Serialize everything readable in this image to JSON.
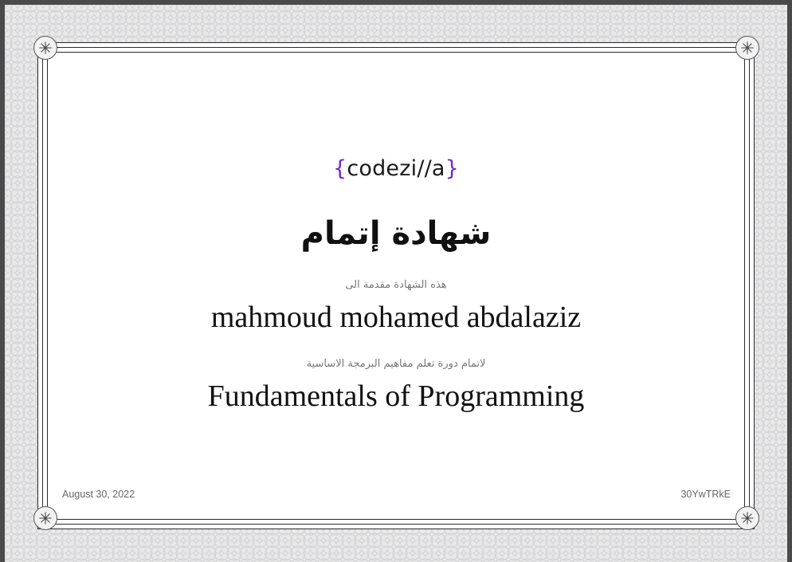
{
  "certificate": {
    "logo": {
      "open_brace": "{",
      "text": "codezi//a",
      "close_brace": "}"
    },
    "title": "شهادة إتمام",
    "presented_to_label": "هذه الشهادة مقدمة الى",
    "recipient_name": "mahmoud mohamed abdalaziz",
    "completion_label": "لاتمام دورة تعلم مفاهيم البرمجة الاساسية",
    "course_name": "Fundamentals of Programming",
    "date": "August 30, 2022",
    "certificate_id": "30YwTRkE"
  },
  "colors": {
    "brand_brace": "#6c2bd9",
    "frame": "#2a2a2a",
    "background_pattern": "#e9e9ea"
  },
  "icons": {
    "corner": "asterisk-ornament-icon"
  }
}
